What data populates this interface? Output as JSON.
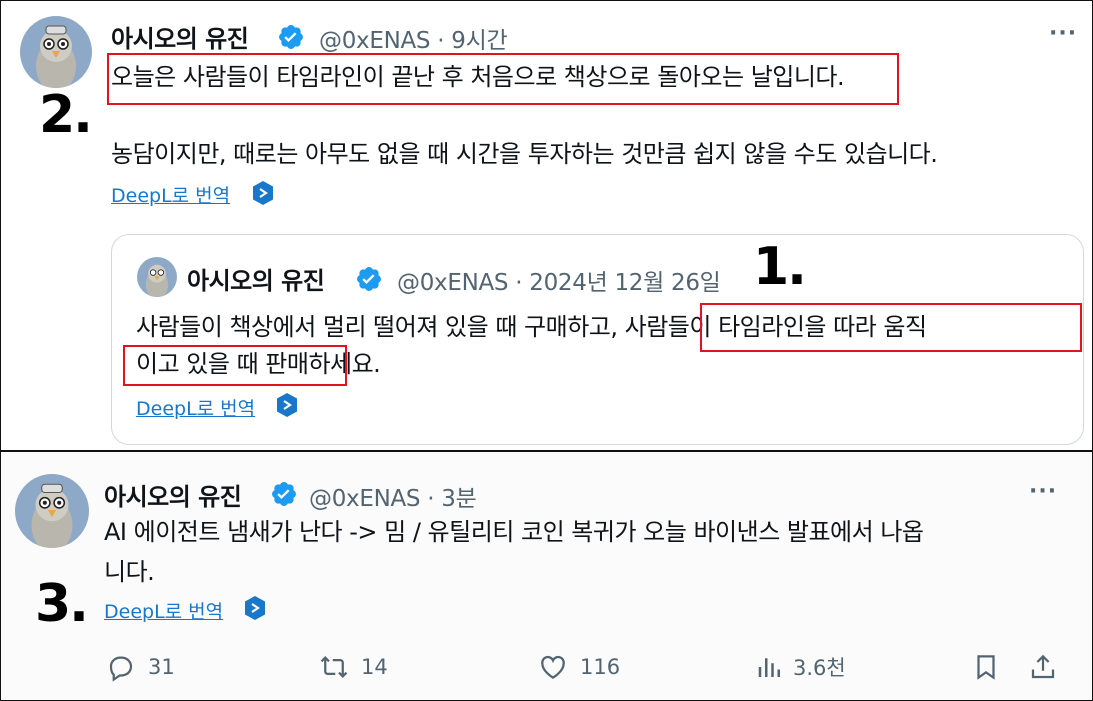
{
  "tweet1": {
    "author": "아시오의 유진",
    "handle_time": "@0xENAS · 9시간",
    "line1": "오늘은 사람들이 타임라인이 끝난 후 처음으로 책상으로 돌아오는 날입니다.",
    "line2": "농담이지만, 때로는 아무도 없을 때 시간을 투자하는 것만큼 쉽지 않을 수도 있습니다.",
    "translate": "DeepL로 번역",
    "annotation": "2.",
    "more": "···"
  },
  "quoted": {
    "author": "아시오의 유진",
    "handle_time": "@0xENAS · 2024년 12월 26일",
    "line1": "사람들이 책상에서 멀리 떨어져 있을 때 구매하고, 사람들이 타임라인을 따라 움직",
    "line2": "이고 있을 때 판매하세요.",
    "translate": "DeepL로 번역",
    "annotation": "1."
  },
  "tweet2": {
    "author": "아시오의 유진",
    "handle_time": "@0xENAS · 3분",
    "line1": "AI 에이전트 냄새가 난다 -> 밈 / 유틸리티 코인 복귀가 오늘 바이낸스 발표에서 나옵",
    "line2": "니다.",
    "translate": "DeepL로 번역",
    "annotation": "3.",
    "more": "···",
    "actions": {
      "replies": "31",
      "retweets": "14",
      "likes": "116",
      "views": "3.6천"
    }
  },
  "colors": {
    "verified": "#1d9bf0",
    "highlight_box": "#e0141e",
    "muted": "#536471",
    "link": "#1877c9"
  },
  "icons": [
    "verified-badge-icon",
    "more-icon",
    "deepl-icon",
    "reply-icon",
    "retweet-icon",
    "like-icon",
    "views-icon",
    "bookmark-icon",
    "share-icon"
  ]
}
